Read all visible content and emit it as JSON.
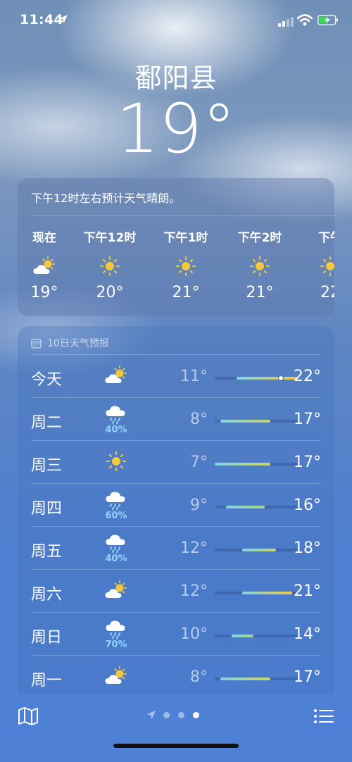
{
  "status_bar": {
    "time": "11:44"
  },
  "location": {
    "city": "鄱阳县",
    "current_temp": "19°"
  },
  "hourly": {
    "summary": "下午12时左右预计天气晴朗。",
    "items": [
      {
        "label": "现在",
        "icon": "cloud-sun-icon",
        "temp": "19°"
      },
      {
        "label": "下午12时",
        "icon": "sun-icon",
        "temp": "20°"
      },
      {
        "label": "下午1时",
        "icon": "sun-icon",
        "temp": "21°"
      },
      {
        "label": "下午2时",
        "icon": "sun-icon",
        "temp": "21°"
      },
      {
        "label": "下午",
        "icon": "sun-icon",
        "temp": "22"
      }
    ]
  },
  "daily": {
    "header": "10日天气预报",
    "range_min": 7,
    "range_max": 22,
    "days": [
      {
        "day": "今天",
        "icon": "cloud-sun-icon",
        "precip": "",
        "low": "11°",
        "high": "22°",
        "low_val": 11,
        "high_val": 22,
        "current": 19
      },
      {
        "day": "周二",
        "icon": "cloud-rain-icon",
        "precip": "40%",
        "low": "8°",
        "high": "17°",
        "low_val": 8,
        "high_val": 17
      },
      {
        "day": "周三",
        "icon": "sun-icon",
        "precip": "",
        "low": "7°",
        "high": "17°",
        "low_val": 7,
        "high_val": 17
      },
      {
        "day": "周四",
        "icon": "cloud-rain-icon",
        "precip": "60%",
        "low": "9°",
        "high": "16°",
        "low_val": 9,
        "high_val": 16
      },
      {
        "day": "周五",
        "icon": "cloud-rain-icon",
        "precip": "40%",
        "low": "12°",
        "high": "18°",
        "low_val": 12,
        "high_val": 18
      },
      {
        "day": "周六",
        "icon": "cloud-sun-icon",
        "precip": "",
        "low": "12°",
        "high": "21°",
        "low_val": 12,
        "high_val": 21
      },
      {
        "day": "周日",
        "icon": "cloud-rain-icon",
        "precip": "70%",
        "low": "10°",
        "high": "14°",
        "low_val": 10,
        "high_val": 14
      },
      {
        "day": "周一",
        "icon": "cloud-sun-icon",
        "precip": "",
        "low": "8°",
        "high": "17°",
        "low_val": 8,
        "high_val": 17
      }
    ]
  },
  "toolbar": {
    "page_count": 3,
    "active_page": 3
  }
}
